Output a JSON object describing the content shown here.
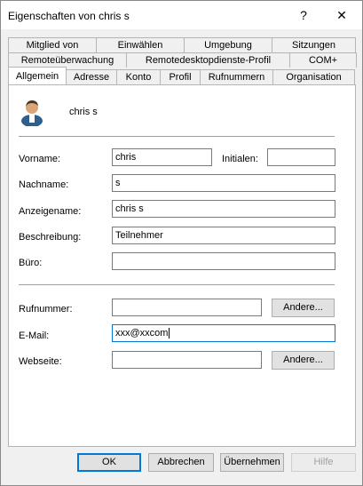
{
  "window": {
    "title": "Eigenschaften von chris s",
    "help_label": "?",
    "close_label": "✕"
  },
  "tabs": {
    "row1": [
      "Mitglied von",
      "Einwählen",
      "Umgebung",
      "Sitzungen"
    ],
    "row2": [
      "Remoteüberwachung",
      "Remotedesktopdienste-Profil",
      "COM+"
    ],
    "row3": [
      "Allgemein",
      "Adresse",
      "Konto",
      "Profil",
      "Rufnummern",
      "Organisation"
    ]
  },
  "user": {
    "display": "chris s"
  },
  "form": {
    "vorname_label": "Vorname:",
    "vorname_value": "chris",
    "initialen_label": "Initialen:",
    "initialen_value": "",
    "nachname_label": "Nachname:",
    "nachname_value": "s",
    "anzeigename_label": "Anzeigename:",
    "anzeigename_value": "chris s",
    "beschreibung_label": "Beschreibung:",
    "beschreibung_value": "Teilnehmer",
    "buero_label": "Büro:",
    "buero_value": "",
    "rufnummer_label": "Rufnummer:",
    "rufnummer_value": "",
    "email_label": "E-Mail:",
    "email_value": "xxx@xxcom",
    "webseite_label": "Webseite:",
    "webseite_value": "",
    "andere_label": "Andere..."
  },
  "buttons": {
    "ok": "OK",
    "abbrechen": "Abbrechen",
    "uebernehmen": "Übernehmen",
    "hilfe": "Hilfe"
  },
  "colors": {
    "focus_border": "#0078d7"
  }
}
